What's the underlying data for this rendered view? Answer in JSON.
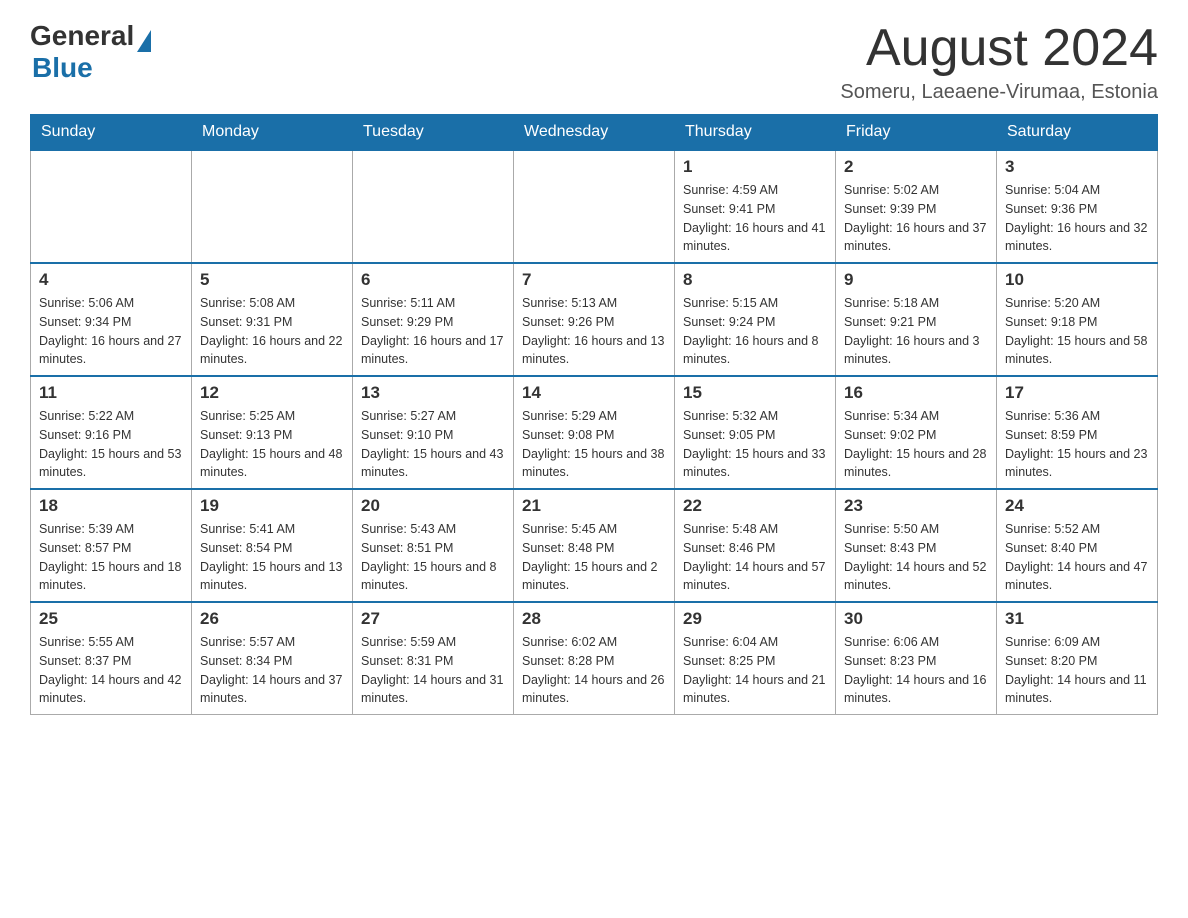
{
  "header": {
    "logo_general": "General",
    "logo_blue": "Blue",
    "title": "August 2024",
    "subtitle": "Someru, Laeaene-Virumaa, Estonia"
  },
  "calendar": {
    "days_of_week": [
      "Sunday",
      "Monday",
      "Tuesday",
      "Wednesday",
      "Thursday",
      "Friday",
      "Saturday"
    ],
    "weeks": [
      {
        "days": [
          {
            "number": "",
            "info": ""
          },
          {
            "number": "",
            "info": ""
          },
          {
            "number": "",
            "info": ""
          },
          {
            "number": "",
            "info": ""
          },
          {
            "number": "1",
            "info": "Sunrise: 4:59 AM\nSunset: 9:41 PM\nDaylight: 16 hours and 41 minutes."
          },
          {
            "number": "2",
            "info": "Sunrise: 5:02 AM\nSunset: 9:39 PM\nDaylight: 16 hours and 37 minutes."
          },
          {
            "number": "3",
            "info": "Sunrise: 5:04 AM\nSunset: 9:36 PM\nDaylight: 16 hours and 32 minutes."
          }
        ]
      },
      {
        "days": [
          {
            "number": "4",
            "info": "Sunrise: 5:06 AM\nSunset: 9:34 PM\nDaylight: 16 hours and 27 minutes."
          },
          {
            "number": "5",
            "info": "Sunrise: 5:08 AM\nSunset: 9:31 PM\nDaylight: 16 hours and 22 minutes."
          },
          {
            "number": "6",
            "info": "Sunrise: 5:11 AM\nSunset: 9:29 PM\nDaylight: 16 hours and 17 minutes."
          },
          {
            "number": "7",
            "info": "Sunrise: 5:13 AM\nSunset: 9:26 PM\nDaylight: 16 hours and 13 minutes."
          },
          {
            "number": "8",
            "info": "Sunrise: 5:15 AM\nSunset: 9:24 PM\nDaylight: 16 hours and 8 minutes."
          },
          {
            "number": "9",
            "info": "Sunrise: 5:18 AM\nSunset: 9:21 PM\nDaylight: 16 hours and 3 minutes."
          },
          {
            "number": "10",
            "info": "Sunrise: 5:20 AM\nSunset: 9:18 PM\nDaylight: 15 hours and 58 minutes."
          }
        ]
      },
      {
        "days": [
          {
            "number": "11",
            "info": "Sunrise: 5:22 AM\nSunset: 9:16 PM\nDaylight: 15 hours and 53 minutes."
          },
          {
            "number": "12",
            "info": "Sunrise: 5:25 AM\nSunset: 9:13 PM\nDaylight: 15 hours and 48 minutes."
          },
          {
            "number": "13",
            "info": "Sunrise: 5:27 AM\nSunset: 9:10 PM\nDaylight: 15 hours and 43 minutes."
          },
          {
            "number": "14",
            "info": "Sunrise: 5:29 AM\nSunset: 9:08 PM\nDaylight: 15 hours and 38 minutes."
          },
          {
            "number": "15",
            "info": "Sunrise: 5:32 AM\nSunset: 9:05 PM\nDaylight: 15 hours and 33 minutes."
          },
          {
            "number": "16",
            "info": "Sunrise: 5:34 AM\nSunset: 9:02 PM\nDaylight: 15 hours and 28 minutes."
          },
          {
            "number": "17",
            "info": "Sunrise: 5:36 AM\nSunset: 8:59 PM\nDaylight: 15 hours and 23 minutes."
          }
        ]
      },
      {
        "days": [
          {
            "number": "18",
            "info": "Sunrise: 5:39 AM\nSunset: 8:57 PM\nDaylight: 15 hours and 18 minutes."
          },
          {
            "number": "19",
            "info": "Sunrise: 5:41 AM\nSunset: 8:54 PM\nDaylight: 15 hours and 13 minutes."
          },
          {
            "number": "20",
            "info": "Sunrise: 5:43 AM\nSunset: 8:51 PM\nDaylight: 15 hours and 8 minutes."
          },
          {
            "number": "21",
            "info": "Sunrise: 5:45 AM\nSunset: 8:48 PM\nDaylight: 15 hours and 2 minutes."
          },
          {
            "number": "22",
            "info": "Sunrise: 5:48 AM\nSunset: 8:46 PM\nDaylight: 14 hours and 57 minutes."
          },
          {
            "number": "23",
            "info": "Sunrise: 5:50 AM\nSunset: 8:43 PM\nDaylight: 14 hours and 52 minutes."
          },
          {
            "number": "24",
            "info": "Sunrise: 5:52 AM\nSunset: 8:40 PM\nDaylight: 14 hours and 47 minutes."
          }
        ]
      },
      {
        "days": [
          {
            "number": "25",
            "info": "Sunrise: 5:55 AM\nSunset: 8:37 PM\nDaylight: 14 hours and 42 minutes."
          },
          {
            "number": "26",
            "info": "Sunrise: 5:57 AM\nSunset: 8:34 PM\nDaylight: 14 hours and 37 minutes."
          },
          {
            "number": "27",
            "info": "Sunrise: 5:59 AM\nSunset: 8:31 PM\nDaylight: 14 hours and 31 minutes."
          },
          {
            "number": "28",
            "info": "Sunrise: 6:02 AM\nSunset: 8:28 PM\nDaylight: 14 hours and 26 minutes."
          },
          {
            "number": "29",
            "info": "Sunrise: 6:04 AM\nSunset: 8:25 PM\nDaylight: 14 hours and 21 minutes."
          },
          {
            "number": "30",
            "info": "Sunrise: 6:06 AM\nSunset: 8:23 PM\nDaylight: 14 hours and 16 minutes."
          },
          {
            "number": "31",
            "info": "Sunrise: 6:09 AM\nSunset: 8:20 PM\nDaylight: 14 hours and 11 minutes."
          }
        ]
      }
    ]
  }
}
